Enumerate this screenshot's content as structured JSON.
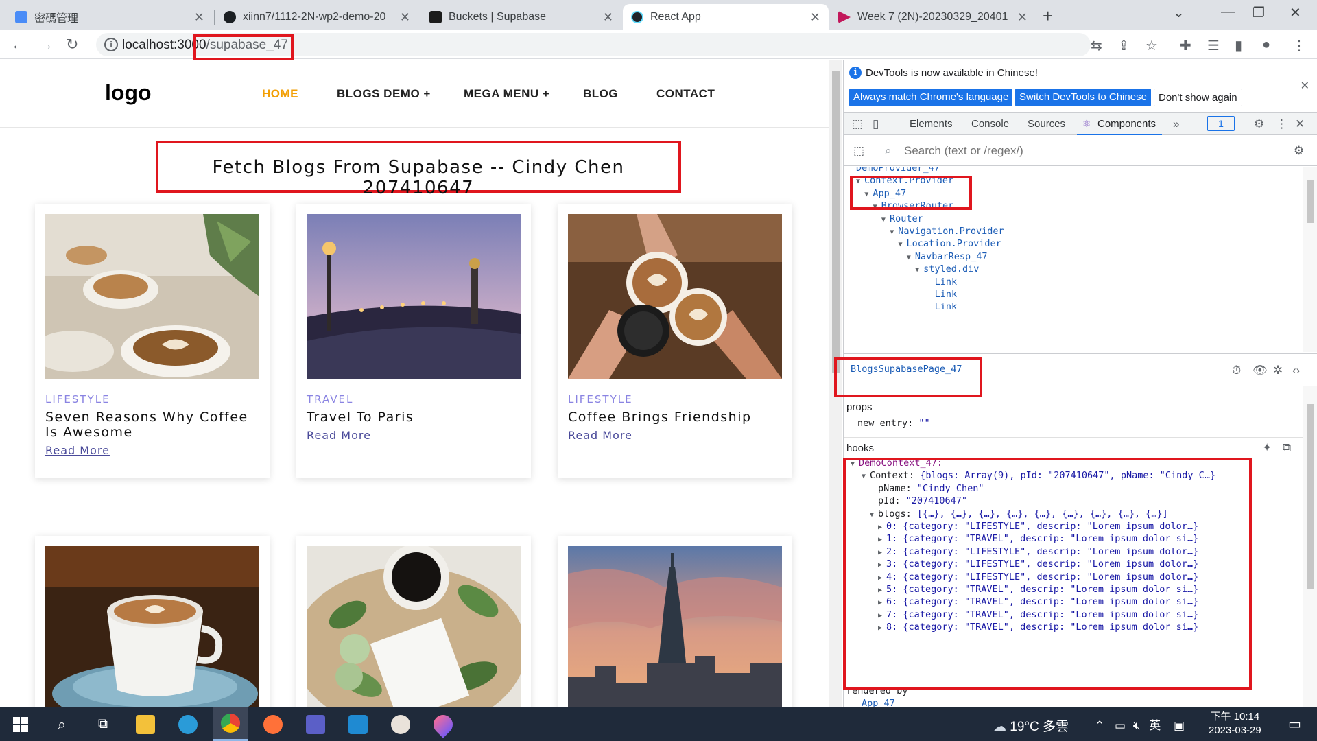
{
  "browser": {
    "tabs": [
      {
        "title": "密碼管理",
        "active": false
      },
      {
        "title": "xiinn7/1112-2N-wp2-demo-20",
        "active": false
      },
      {
        "title": "Buckets | Supabase",
        "active": false
      },
      {
        "title": "React App",
        "active": true
      },
      {
        "title": "Week 7 (2N)-20230329_20401",
        "active": false
      }
    ],
    "url_host": "localhost:3000",
    "url_path": "/supabase_47"
  },
  "site": {
    "logo": "logo",
    "nav": [
      "HOME",
      "BLOGS DEMO +",
      "MEGA MENU +",
      "BLOG",
      "CONTACT"
    ],
    "page_title": "Fetch Blogs From Supabase -- Cindy Chen 207410647",
    "read_more": "Read More",
    "cards": [
      {
        "category": "LIFESTYLE",
        "title": "Seven Reasons Why Coffee Is Awesome"
      },
      {
        "category": "TRAVEL",
        "title": "Travel To Paris"
      },
      {
        "category": "LIFESTYLE",
        "title": "Coffee Brings Friendship"
      }
    ]
  },
  "devtools": {
    "info_text": "DevTools is now available in Chinese!",
    "btn_match": "Always match Chrome's language",
    "btn_switch": "Switch DevTools to Chinese",
    "btn_dismiss": "Don't show again",
    "tabs": [
      "Elements",
      "Console",
      "Sources",
      "Components"
    ],
    "badge": "1",
    "search_placeholder": "Search (text or /regex/)",
    "tree": [
      {
        "label": "DemoProvider_47",
        "indent": 0,
        "arrow": false
      },
      {
        "label": "Context.Provider",
        "indent": 0,
        "arrow": true
      },
      {
        "label": "App_47",
        "indent": 1,
        "arrow": true
      },
      {
        "label": "BrowserRouter",
        "indent": 2,
        "arrow": true
      },
      {
        "label": "Router",
        "indent": 3,
        "arrow": true
      },
      {
        "label": "Navigation.Provider",
        "indent": 4,
        "arrow": true
      },
      {
        "label": "Location.Provider",
        "indent": 5,
        "arrow": true
      },
      {
        "label": "NavbarResp_47",
        "indent": 6,
        "arrow": true
      },
      {
        "label": "styled.div",
        "indent": 7,
        "arrow": true
      },
      {
        "label": "Link",
        "indent": 8,
        "arrow": false
      },
      {
        "label": "Link",
        "indent": 8,
        "arrow": false
      },
      {
        "label": "Link",
        "indent": 8,
        "arrow": false
      }
    ],
    "selected_component": "BlogsSupabasePage_47",
    "props_label": "props",
    "props_key": "new entry:",
    "props_val": "\"\"",
    "hooks_label": "hooks",
    "hook_name": "DemoContext_47:",
    "context_key": "Context:",
    "context_summary": "{blogs: Array(9), pId: \"207410647\", pName: \"Cindy C…}",
    "pname_key": "pName:",
    "pname_val": "\"Cindy Chen\"",
    "pid_key": "pId:",
    "pid_val": "\"207410647\"",
    "blogs_key": "blogs:",
    "blogs_summary": "[{…}, {…}, {…}, {…}, {…}, {…}, {…}, {…}, {…}]",
    "blog_rows": [
      "0: {category: \"LIFESTYLE\", descrip: \"Lorem ipsum dolor…}",
      "1: {category: \"TRAVEL\", descrip: \"Lorem ipsum dolor si…}",
      "2: {category: \"LIFESTYLE\", descrip: \"Lorem ipsum dolor…}",
      "3: {category: \"LIFESTYLE\", descrip: \"Lorem ipsum dolor…}",
      "4: {category: \"LIFESTYLE\", descrip: \"Lorem ipsum dolor…}",
      "5: {category: \"TRAVEL\", descrip: \"Lorem ipsum dolor si…}",
      "6: {category: \"TRAVEL\", descrip: \"Lorem ipsum dolor si…}",
      "7: {category: \"TRAVEL\", descrip: \"Lorem ipsum dolor si…}",
      "8: {category: \"TRAVEL\", descrip: \"Lorem ipsum dolor si…}"
    ],
    "rendered_by": "rendered by",
    "rendered_by_item": "App_47"
  },
  "taskbar": {
    "weather": "19°C 多雲",
    "ime": "英",
    "time": "下午 10:14",
    "date": "2023-03-29"
  },
  "colors": {
    "accent_nav": "#f29f05",
    "category": "#8a84e2",
    "annotation_red": "#e0161e",
    "devtools_blue": "#1a73e8"
  }
}
